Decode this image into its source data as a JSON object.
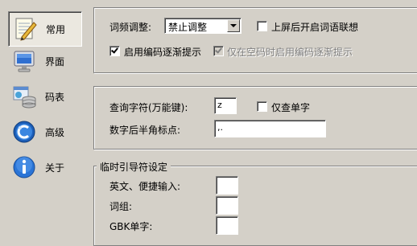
{
  "sidebar": {
    "items": [
      {
        "label": "常用",
        "icon": "notepad-icon",
        "active": true
      },
      {
        "label": "界面",
        "icon": "monitor-icon",
        "active": false
      },
      {
        "label": "码表",
        "icon": "database-icon",
        "active": false
      },
      {
        "label": "高级",
        "icon": "advanced-icon",
        "active": false
      },
      {
        "label": "关于",
        "icon": "info-icon",
        "active": false
      }
    ]
  },
  "general": {
    "freq_label": "词频调整:",
    "freq_value": "禁止调整",
    "assoc_label": "上屏后开启词语联想",
    "assoc_checked": false,
    "hint_label": "启用编码逐渐提示",
    "hint_checked": true,
    "hint_space_label": "仅在空码时启用编码逐渐提示",
    "hint_space_checked": true,
    "hint_space_enabled": false
  },
  "lookup": {
    "wildcard_label": "查询字符(万能键):",
    "wildcard_value": "z",
    "single_label": "仅查单字",
    "single_checked": false,
    "halfwidth_label": "数字后半角标点:",
    "halfwidth_value": ",."
  },
  "guide": {
    "title": "临时引导符设定",
    "english_label": "英文、便捷输入:",
    "english_value": "",
    "phrase_label": "词组:",
    "phrase_value": "",
    "gbk_label": "GBK单字:",
    "gbk_value": ""
  },
  "colors": {
    "face": "#d4d0c8",
    "active_tab": "#ebe8e0",
    "disabled_text": "#808080"
  }
}
